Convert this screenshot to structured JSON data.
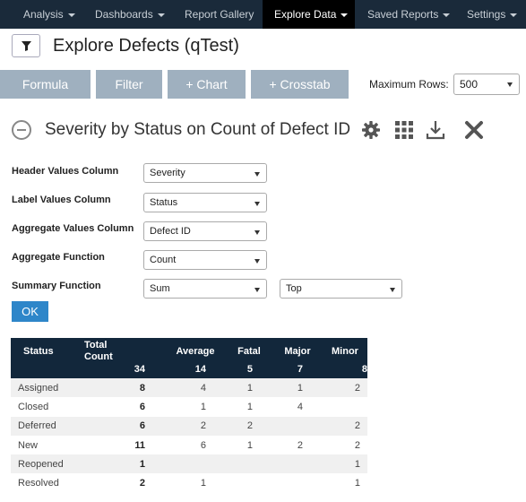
{
  "nav": {
    "items": [
      {
        "label": "Analysis",
        "dropdown": true
      },
      {
        "label": "Dashboards",
        "dropdown": true
      },
      {
        "label": "Report Gallery",
        "dropdown": false
      },
      {
        "label": "Explore Data",
        "dropdown": true,
        "active": true
      },
      {
        "label": "Saved Reports",
        "dropdown": true
      },
      {
        "label": "Settings",
        "dropdown": true
      }
    ]
  },
  "header": {
    "filter_icon": "filter-icon",
    "title": "Explore Defects (qTest)"
  },
  "toolbar": {
    "formula_label": "Formula",
    "filter_label": "Filter",
    "chart_label": "+ Chart",
    "crosstab_label": "+ Crosstab",
    "max_rows_label": "Maximum Rows:",
    "max_rows_value": "500"
  },
  "section": {
    "title": "Severity by Status on Count of Defect ID",
    "icons": [
      "collapse-icon",
      "gear-icon",
      "grid-icon",
      "download-icon",
      "close-icon"
    ]
  },
  "form": {
    "header_values_label": "Header Values Column",
    "header_values_value": "Severity",
    "label_values_label": "Label Values Column",
    "label_values_value": "Status",
    "aggregate_values_label": "Aggregate Values Column",
    "aggregate_values_value": "Defect ID",
    "aggregate_function_label": "Aggregate Function",
    "aggregate_function_value": "Count",
    "summary_function_label": "Summary Function",
    "summary_function_value": "Sum",
    "summary_position_value": "Top",
    "ok_label": "OK"
  },
  "table": {
    "columns": [
      "Status",
      "Total Count",
      "Average",
      "Fatal",
      "Major",
      "Minor"
    ],
    "totals": [
      "",
      "34",
      "14",
      "5",
      "7",
      "8"
    ],
    "rows": [
      {
        "status": "Assigned",
        "total": "8",
        "average": "4",
        "fatal": "1",
        "major": "1",
        "minor": "2"
      },
      {
        "status": "Closed",
        "total": "6",
        "average": "1",
        "fatal": "1",
        "major": "4",
        "minor": ""
      },
      {
        "status": "Deferred",
        "total": "6",
        "average": "2",
        "fatal": "2",
        "major": "",
        "minor": "2"
      },
      {
        "status": "New",
        "total": "11",
        "average": "6",
        "fatal": "1",
        "major": "2",
        "minor": "2"
      },
      {
        "status": "Reopened",
        "total": "1",
        "average": "",
        "fatal": "",
        "major": "",
        "minor": "1"
      },
      {
        "status": "Resolved",
        "total": "2",
        "average": "1",
        "fatal": "",
        "major": "",
        "minor": "1"
      }
    ],
    "highlight_color": "#c0392b"
  },
  "colors": {
    "nav_bg": "#1a2a3a",
    "nav_active_bg": "#000000",
    "toolbar_button": "#9fb0bf",
    "ok_button": "#2e86c9",
    "table_header": "#12273b"
  }
}
